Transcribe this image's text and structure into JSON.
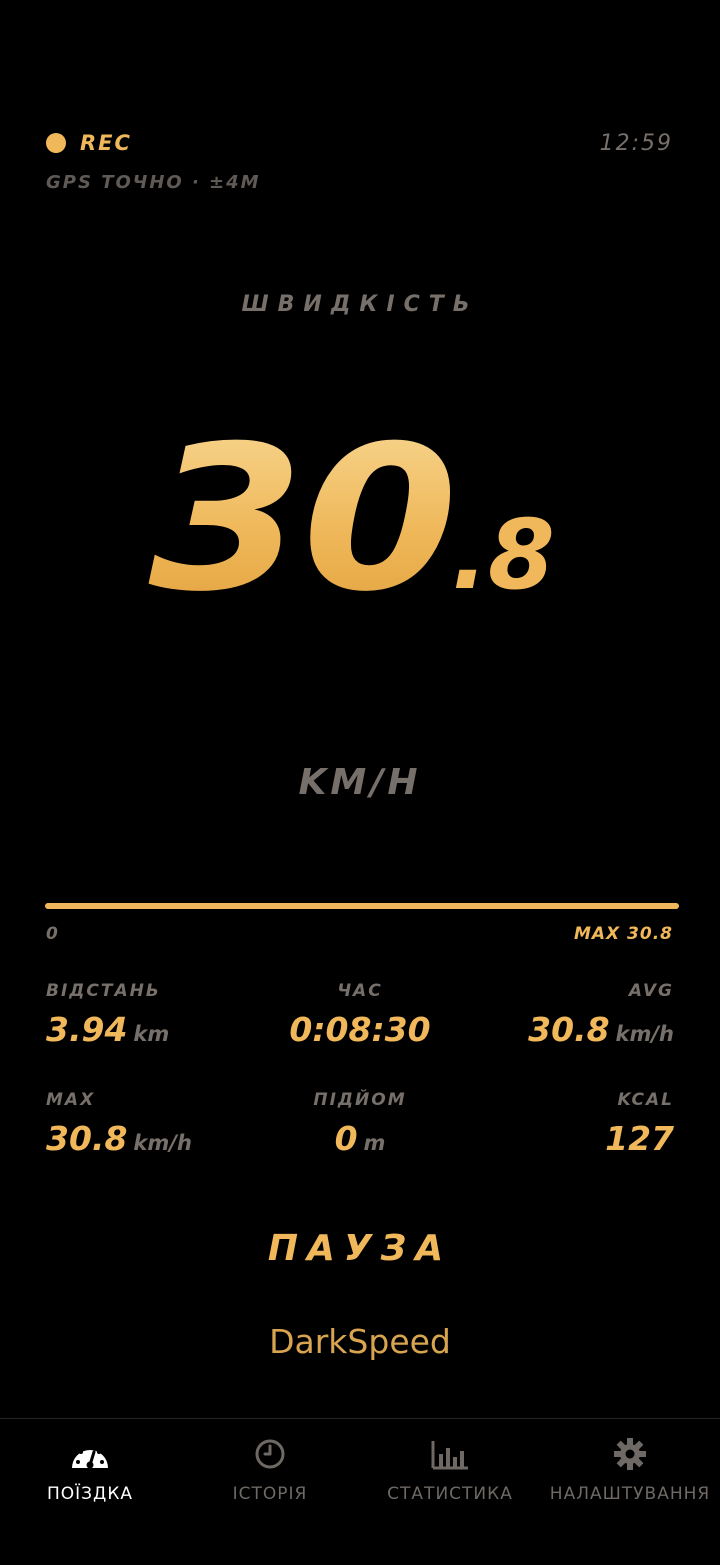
{
  "status": {
    "rec_label": "REC",
    "clock": "12:59",
    "gps": "GPS ТОЧНО · ±4М"
  },
  "speed": {
    "title": "ШВИДКІСТЬ",
    "integer": "30",
    "decimal": ".8",
    "unit": "KM/H"
  },
  "progress": {
    "min_label": "0",
    "max_label": "MAX 30.8",
    "fill_fraction": 1.0
  },
  "stats": {
    "distance": {
      "label": "ВІДСТАНЬ",
      "value": "3.94",
      "unit": "km"
    },
    "time": {
      "label": "ЧАС",
      "value": "0:08:30"
    },
    "avg": {
      "label": "AVG",
      "value": "30.8",
      "unit": "km/h"
    },
    "max": {
      "label": "MAX",
      "value": "30.8",
      "unit": "km/h"
    },
    "climb": {
      "label": "ПІДЙОМ",
      "value": "0",
      "unit": "m"
    },
    "kcal": {
      "label": "KCAL",
      "value": "127"
    }
  },
  "pause_label": "ПАУЗА",
  "brand": "DarkSpeed",
  "nav": {
    "items": [
      {
        "label": "ПОЇЗДКА",
        "icon": "speedometer-icon",
        "active": true
      },
      {
        "label": "ІСТОРІЯ",
        "icon": "clock-icon",
        "active": false
      },
      {
        "label": "СТАТИСТИКА",
        "icon": "bar-chart-icon",
        "active": false
      },
      {
        "label": "НАЛАШТУВАННЯ",
        "icon": "gear-icon",
        "active": false
      }
    ]
  },
  "colors": {
    "accent": "#f0b85a",
    "muted": "#77706a",
    "background": "#000000"
  }
}
